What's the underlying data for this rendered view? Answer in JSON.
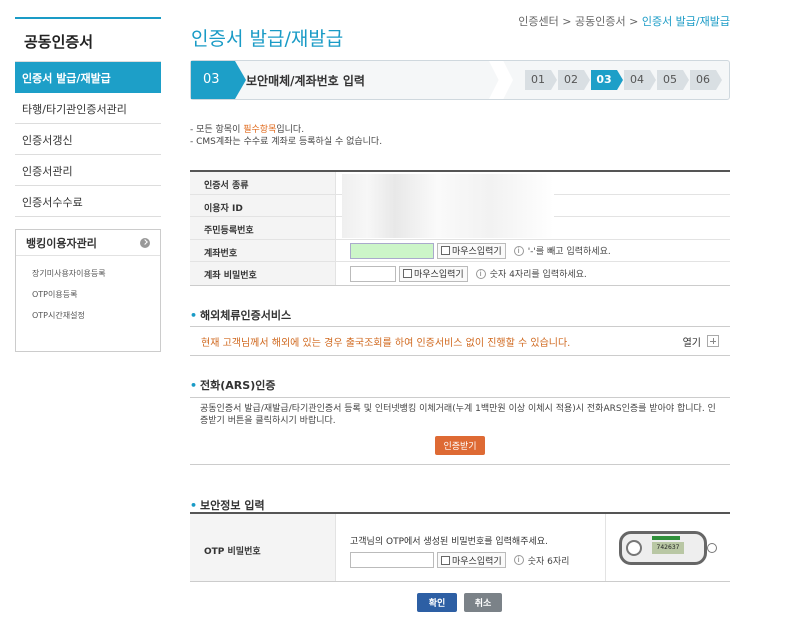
{
  "sidebar": {
    "title": "공동인증서",
    "items": [
      {
        "label": "인증서 발급/재발급",
        "active": true
      },
      {
        "label": "타행/타기관인증서관리",
        "active": false
      },
      {
        "label": "인증서갱신",
        "active": false
      },
      {
        "label": "인증서관리",
        "active": false
      },
      {
        "label": "인증서수수료",
        "active": false
      }
    ],
    "box_title": "뱅킹이용자관리",
    "box_items": [
      "장기미사용자이용등록",
      "OTP이용등록",
      "OTP시간재설정"
    ]
  },
  "breadcrumb": {
    "part1": "인증센터",
    "sep": " > ",
    "part2": "공동인증서",
    "current": "인증서 발급/재발급"
  },
  "page_title": "인증서 발급/재발급",
  "stepbar": {
    "current_num": "03",
    "current_label": "보안매체/계좌번호 입력",
    "steps": [
      "01",
      "02",
      "03",
      "04",
      "05",
      "06"
    ],
    "active_index": 2
  },
  "notes": {
    "line1_prefix": "- 모든 항목이 ",
    "line1_req": "필수항목",
    "line1_suffix": "입니다.",
    "line2": "- CMS계좌는 수수료 계좌로 등록하실 수 없습니다."
  },
  "form": {
    "rows": [
      {
        "label": "인증서 종류"
      },
      {
        "label": "이용자 ID"
      },
      {
        "label": "주민등록번호"
      },
      {
        "label": "계좌번호"
      },
      {
        "label": "계좌 비밀번호"
      }
    ],
    "mouse_input": "마우스입력기",
    "account_hint": "'-'를 빼고 입력하세요.",
    "pw_hint": "숫자 4자리를 입력하세요."
  },
  "overseas": {
    "title": "해외체류인증서비스",
    "message": "현재 고객님께서 해외에 있는 경우 출국조회를 하여 인증서비스 없이 진행할 수 있습니다.",
    "open_label": "열기"
  },
  "ars": {
    "title": "전화(ARS)인증",
    "text": "공동인증서 발급/재발급/타기관인증서 등록 및 인터넷뱅킹 이체거래(누계 1백만원 이상 이체시 적용)시 전화ARS인증를 받아야 합니다. 인증받기 버튼을 클릭하시기 바랍니다.",
    "button": "인증받기"
  },
  "security": {
    "title": "보안정보 입력",
    "otp_label": "OTP 비밀번호",
    "otp_desc": "고객님의 OTP에서 생성된 비밀번호를 입력해주세요.",
    "otp_hint": "숫자 6자리",
    "otp_screen": "742637"
  },
  "buttons": {
    "ok": "확인",
    "cancel": "취소"
  }
}
